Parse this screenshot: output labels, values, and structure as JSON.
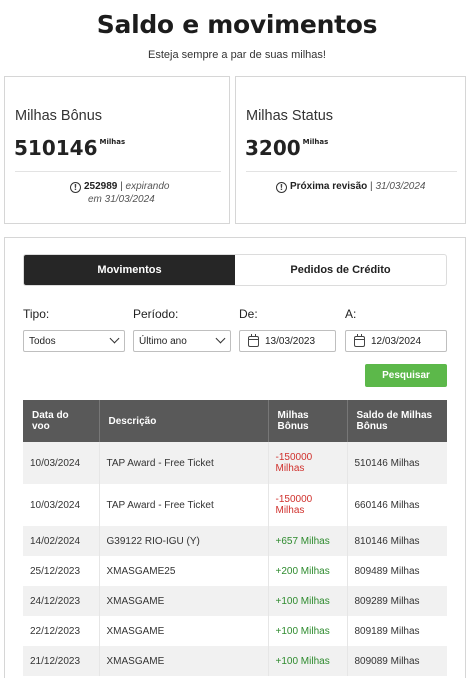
{
  "header": {
    "title": "Saldo e movimentos",
    "subtitle": "Esteja sempre a par de suas milhas!"
  },
  "cards": {
    "bonus": {
      "title": "Milhas Bônus",
      "value": "510146",
      "unit": "Milhas",
      "info_amount": "252989",
      "info_sep": "|",
      "info_text_1": "expirando",
      "info_text_2": "em 31/03/2024"
    },
    "status": {
      "title": "Milhas Status",
      "value": "3200",
      "unit": "Milhas",
      "info_label": "Próxima revisão",
      "info_sep": "|",
      "info_date": "31/03/2024"
    }
  },
  "tabs": [
    {
      "label": "Movimentos",
      "active": true
    },
    {
      "label": "Pedidos de Crédito",
      "active": false
    }
  ],
  "filters": {
    "tipo": {
      "label": "Tipo:",
      "value": "Todos"
    },
    "periodo": {
      "label": "Período:",
      "value": "Último ano"
    },
    "de": {
      "label": "De:",
      "value": "13/03/2023"
    },
    "a": {
      "label": "A:",
      "value": "12/03/2024"
    },
    "search_label": "Pesquisar"
  },
  "table": {
    "columns": [
      "Data do voo",
      "Descrição",
      "Milhas Bônus",
      "Saldo de Milhas Bônus"
    ],
    "column_lines": [
      [
        "Data do",
        "voo"
      ],
      [
        "Descrição"
      ],
      [
        "Milhas",
        "Bônus"
      ],
      [
        "Saldo de Milhas",
        "Bônus"
      ]
    ],
    "rows": [
      {
        "date": "10/03/2024",
        "desc": "TAP Award - Free Ticket",
        "miles": "-150000 Milhas",
        "miles_l1": "-150000",
        "miles_l2": "Milhas",
        "balance": "510146 Milhas",
        "kind": "neg"
      },
      {
        "date": "10/03/2024",
        "desc": "TAP Award - Free Ticket",
        "miles": "-150000 Milhas",
        "miles_l1": "-150000",
        "miles_l2": "Milhas",
        "balance": "660146 Milhas",
        "kind": "neg"
      },
      {
        "date": "14/02/2024",
        "desc": "G39122 RIO-IGU (Y)",
        "miles": "+657 Milhas",
        "balance": "810146 Milhas",
        "kind": "pos"
      },
      {
        "date": "25/12/2023",
        "desc": "XMASGAME25",
        "miles": "+200 Milhas",
        "balance": "809489 Milhas",
        "kind": "pos"
      },
      {
        "date": "24/12/2023",
        "desc": "XMASGAME",
        "miles": "+100 Milhas",
        "balance": "809289 Milhas",
        "kind": "pos"
      },
      {
        "date": "22/12/2023",
        "desc": "XMASGAME",
        "miles": "+100 Milhas",
        "balance": "809189 Milhas",
        "kind": "pos"
      },
      {
        "date": "21/12/2023",
        "desc": "XMASGAME",
        "miles": "+100 Milhas",
        "balance": "809089 Milhas",
        "kind": "pos"
      }
    ]
  },
  "colors": {
    "accent_green": "#5cb84a",
    "negative_red": "#d0312d",
    "positive_green": "#2e8b2e",
    "active_tab": "#262626",
    "table_header": "#595959"
  },
  "icons": {
    "info": "info-circle-icon",
    "calendar": "calendar-icon",
    "dropdown": "chevron-down-icon"
  }
}
